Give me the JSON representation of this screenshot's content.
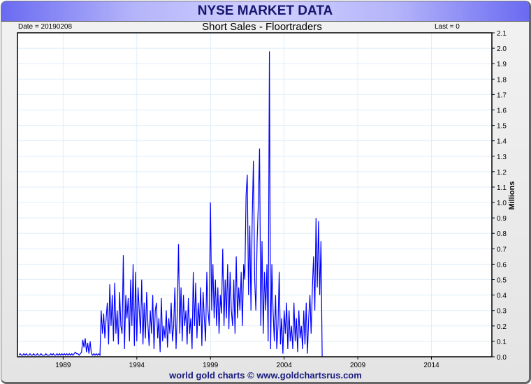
{
  "header": {
    "title": "NYSE MARKET DATA",
    "date_label": "Date = 20190208",
    "last_label": "Last = 0"
  },
  "footer": {
    "credit": "world gold charts © www.goldchartsrus.com"
  },
  "colors": {
    "line": "#0000ff",
    "grid": "#dfeef8",
    "header_edge": "#6a6af2",
    "title": "#16166e"
  },
  "chart_data": {
    "type": "line",
    "title": "Short Sales - Floortraders",
    "xlabel": "",
    "ylabel": "Millions",
    "xlim": [
      1985.9,
      2018.1
    ],
    "ylim": [
      0,
      2.1
    ],
    "x_ticks": [
      1989,
      1994,
      1999,
      2004,
      2009,
      2014
    ],
    "y_ticks": [
      0.0,
      0.1,
      0.2,
      0.3,
      0.4,
      0.5,
      0.6,
      0.7,
      0.8,
      0.9,
      1.0,
      1.1,
      1.2,
      1.3,
      1.4,
      1.5,
      1.6,
      1.7,
      1.8,
      1.9,
      2.0,
      2.1
    ],
    "grid": true,
    "series": [
      {
        "name": "Short Sales - Floortraders",
        "x_start": 1986.0,
        "x_step_years": 0.08333,
        "values": [
          0.01,
          0.02,
          0.01,
          0.01,
          0.02,
          0.01,
          0.02,
          0.01,
          0.01,
          0.02,
          0.01,
          0.01,
          0.02,
          0.01,
          0.01,
          0.02,
          0.01,
          0.01,
          0.02,
          0.01,
          0.01,
          0.01,
          0.02,
          0.01,
          0.01,
          0.01,
          0.02,
          0.01,
          0.02,
          0.01,
          0.01,
          0.02,
          0.01,
          0.02,
          0.01,
          0.02,
          0.01,
          0.02,
          0.01,
          0.02,
          0.01,
          0.02,
          0.01,
          0.02,
          0.01,
          0.02,
          0.03,
          0.02,
          0.02,
          0.01,
          0.02,
          0.03,
          0.11,
          0.06,
          0.12,
          0.03,
          0.09,
          0.02,
          0.1,
          0.02,
          0.01,
          0.02,
          0.01,
          0.02,
          0.01,
          0.02,
          0.01,
          0.3,
          0.15,
          0.28,
          0.12,
          0.25,
          0.35,
          0.08,
          0.47,
          0.2,
          0.4,
          0.1,
          0.48,
          0.15,
          0.3,
          0.08,
          0.42,
          0.2,
          0.15,
          0.66,
          0.05,
          0.4,
          0.25,
          0.38,
          0.1,
          0.5,
          0.2,
          0.6,
          0.07,
          0.55,
          0.1,
          0.45,
          0.3,
          0.15,
          0.5,
          0.08,
          0.35,
          0.12,
          0.42,
          0.22,
          0.07,
          0.3,
          0.15,
          0.4,
          0.05,
          0.3,
          0.35,
          0.12,
          0.25,
          0.03,
          0.38,
          0.1,
          0.2,
          0.12,
          0.3,
          0.06,
          0.25,
          0.15,
          0.35,
          0.1,
          0.2,
          0.45,
          0.05,
          0.3,
          0.73,
          0.15,
          0.45,
          0.1,
          0.4,
          0.2,
          0.3,
          0.08,
          0.38,
          0.15,
          0.25,
          0.05,
          0.55,
          0.2,
          0.48,
          0.12,
          0.35,
          0.2,
          0.45,
          0.07,
          0.42,
          0.25,
          0.1,
          0.55,
          0.3,
          0.2,
          1.0,
          0.3,
          0.6,
          0.25,
          0.5,
          0.2,
          0.45,
          0.15,
          0.4,
          0.28,
          0.7,
          0.2,
          0.5,
          0.25,
          0.6,
          0.18,
          0.55,
          0.3,
          0.2,
          0.5,
          0.15,
          0.65,
          0.25,
          0.45,
          0.3,
          0.55,
          0.2,
          0.6,
          0.5,
          1.05,
          1.18,
          0.4,
          0.85,
          0.3,
          0.9,
          1.27,
          0.5,
          0.3,
          0.75,
          1.0,
          1.35,
          0.2,
          0.75,
          0.15,
          0.55,
          0.3,
          0.6,
          0.1,
          1.98,
          0.05,
          0.6,
          0.3,
          0.1,
          0.4,
          0.05,
          0.2,
          0.55,
          0.08,
          0.25,
          0.02,
          0.3,
          0.15,
          0.35,
          0.05,
          0.3,
          0.1,
          0.2,
          0.05,
          0.35,
          0.1,
          0.25,
          0.03,
          0.3,
          0.12,
          0.2,
          0.05,
          0.3,
          0.08,
          0.35,
          0.02,
          0.25,
          0.4,
          0.15,
          0.45,
          0.65,
          0.3,
          0.9,
          0.45,
          0.88,
          0.4,
          0.75,
          0.0
        ]
      }
    ]
  }
}
